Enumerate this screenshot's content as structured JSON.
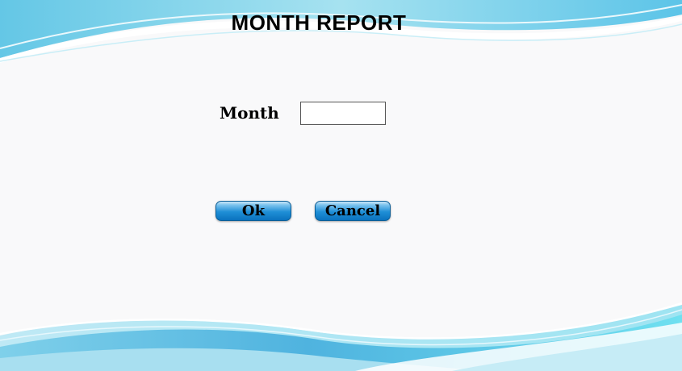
{
  "title": "MONTH REPORT",
  "form": {
    "month_label": "Month",
    "month_value": ""
  },
  "buttons": {
    "ok_label": "Ok",
    "cancel_label": "Cancel"
  },
  "colors": {
    "background": "#f9f9fa",
    "wave_light": "#8fd9ec",
    "wave_dark": "#3fa8d9",
    "button": "#1f8fd6"
  }
}
